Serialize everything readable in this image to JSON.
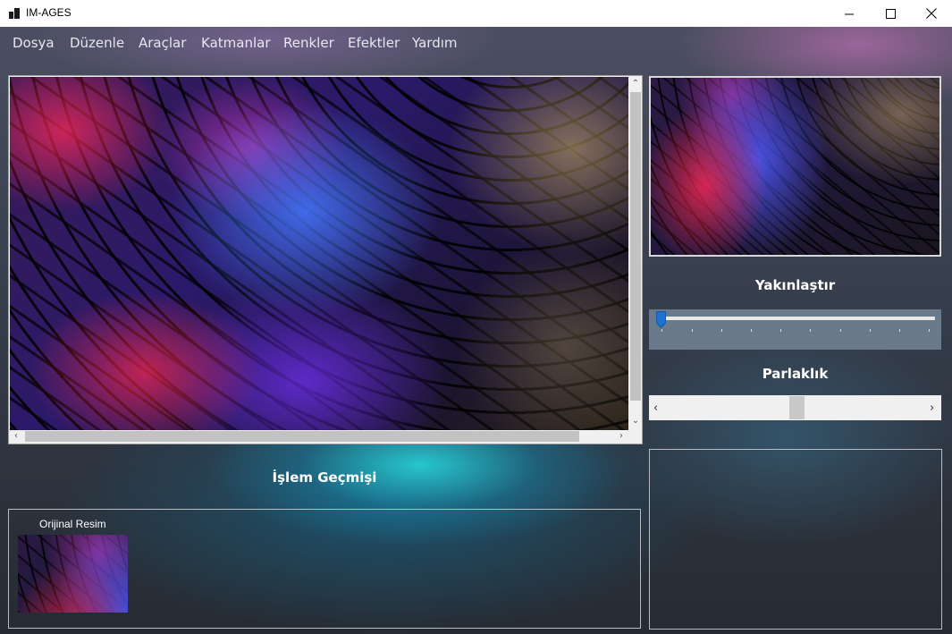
{
  "window": {
    "title": "IM-AGES",
    "icons": [
      "app-icon",
      "minimize-icon",
      "maximize-icon",
      "close-icon"
    ]
  },
  "menu": {
    "items": [
      {
        "label": "Dosya"
      },
      {
        "label": "Düzenle"
      },
      {
        "label": "Araçlar"
      },
      {
        "label": "Katmanlar"
      },
      {
        "label": "Renkler"
      },
      {
        "label": "Efektler"
      },
      {
        "label": "Yardım"
      }
    ]
  },
  "side": {
    "zoom_label": "Yakınlaştır",
    "zoom_value": 0,
    "brightness_label": "Parlaklık",
    "brightness_value": 0.5
  },
  "history": {
    "title": "İşlem Geçmişi",
    "items": [
      {
        "label": "Orijinal Resim"
      }
    ]
  },
  "colors": {
    "zoom_track_bg": "#6b7a8a",
    "zoom_thumb": "#1e72d0",
    "title_bar_bg": "#ffffff"
  }
}
